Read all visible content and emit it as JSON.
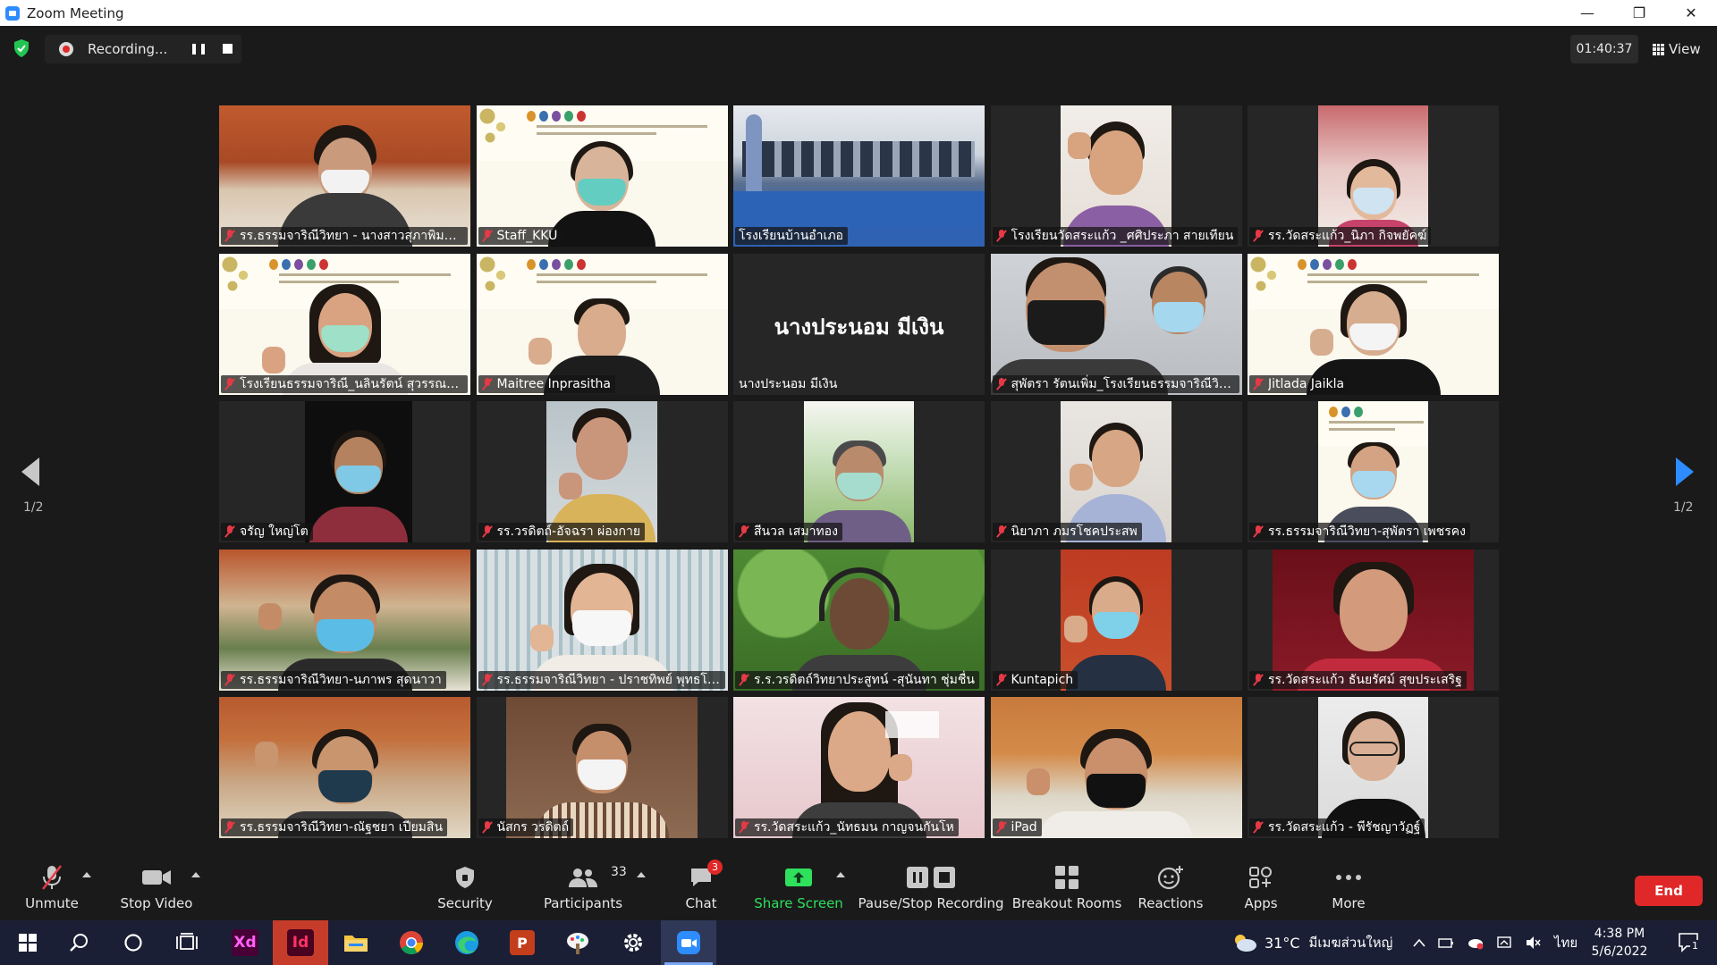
{
  "window": {
    "title": "Zoom Meeting",
    "controls": [
      "—",
      "❐",
      "✕"
    ]
  },
  "top": {
    "recording_label": "Recording...",
    "timer": "01:40:37",
    "view_label": "View"
  },
  "pagination": {
    "left": "1/2",
    "right": "1/2"
  },
  "participants": [
    {
      "name": "รร.ธรรมจาริณีวิทยา - นางสาวสุภาพิมล...",
      "muted": true
    },
    {
      "name": "Staff_KKU",
      "muted": true
    },
    {
      "name": "โรงเรียนบ้านอำเภอ",
      "muted": false,
      "active_speaker": true
    },
    {
      "name": "โรงเรียนวัดสระแก้ว _ศศิประภา สายเทียน",
      "muted": true
    },
    {
      "name": "รร.วัดสระแก้ว_นิภา กิจพยัคฆ์",
      "muted": true
    },
    {
      "name": "โรงเรียนธรรมจาริณี_นลินรัตน์ สุวรรณปร...",
      "muted": true
    },
    {
      "name": "Maitree Inprasitha",
      "muted": true
    },
    {
      "name": "นางประนอม มีเงิน",
      "muted": false,
      "video_off": true,
      "display_name": "นางประนอม มีเงิน"
    },
    {
      "name": "สุพัตรา รัตนเพิ่ม_โรงเรียนธรรมจาริณีวิท...",
      "muted": true
    },
    {
      "name": "Jitlada Jaikla",
      "muted": true
    },
    {
      "name": "จรัญ ใหญ่โต",
      "muted": true
    },
    {
      "name": "รร.วรดิตถ์-อัจฉรา ผ่องกาย",
      "muted": true
    },
    {
      "name": "สีนวล เสมาทอง",
      "muted": true
    },
    {
      "name": "นิยาภา ภมรโชคประสพ",
      "muted": true
    },
    {
      "name": "รร.ธรรมจาริณีวิทยา-สุพัตรา เพชรคง",
      "muted": true
    },
    {
      "name": "รร.ธรรมจาริณีวิทยา-นภาพร สุดนาวา",
      "muted": true
    },
    {
      "name": "รร.ธรรมจาริณีวิทยา - ปราชทิพย์ พุทธโคตร",
      "muted": true
    },
    {
      "name": "ร.ร.วรดิตถ์วิทยาประสูทน์ -สุนันทา ชุ่มชื่น",
      "muted": true
    },
    {
      "name": "Kuntapich",
      "muted": true
    },
    {
      "name": "รร.วัดสระแก้ว ธันยรัศม์ สุขประเสริฐ",
      "muted": true
    },
    {
      "name": "รร.ธรรมจาริณีวิทยา-ณัฐชยา เปียมสิน",
      "muted": true
    },
    {
      "name": "นัสกร วรดิตถ์",
      "muted": true
    },
    {
      "name": "รร.วัดสระแก้ว_นัทธมน กาญจนกันโห",
      "muted": true
    },
    {
      "name": "iPad",
      "muted": true
    },
    {
      "name": "รร.วัดสระแก้ว - พีรัชญาวัฏฐ์",
      "muted": true
    }
  ],
  "toolbar": {
    "unmute": "Unmute",
    "stop_video": "Stop Video",
    "security": "Security",
    "participants": "Participants",
    "participants_count": "33",
    "chat": "Chat",
    "chat_badge": "3",
    "share_screen": "Share Screen",
    "pause_stop_recording": "Pause/Stop Recording",
    "breakout_rooms": "Breakout Rooms",
    "reactions": "Reactions",
    "apps": "Apps",
    "more": "More",
    "end": "End"
  },
  "taskbar": {
    "weather_temp": "31°C",
    "weather_desc": "มีเมฆส่วนใหญ่",
    "language": "ไทย",
    "time": "4:38 PM",
    "date": "5/6/2022",
    "notification_count": "1",
    "apps": [
      "start-icon",
      "search-icon",
      "cortana-icon",
      "task-view-icon",
      "adobe-xd-icon",
      "indesign-icon",
      "file-explorer-icon",
      "chrome-icon",
      "edge-icon",
      "powerpoint-icon",
      "paint-icon",
      "settings-icon",
      "zoom-icon"
    ],
    "xd_label": "Xd",
    "id_label": "Id",
    "ppt_label": "P"
  },
  "colors": {
    "accent": "#2d8cff",
    "mute_red": "#e63946",
    "active_border": "#e0e547",
    "share_green": "#2ee05c",
    "end_red": "#e02828"
  }
}
